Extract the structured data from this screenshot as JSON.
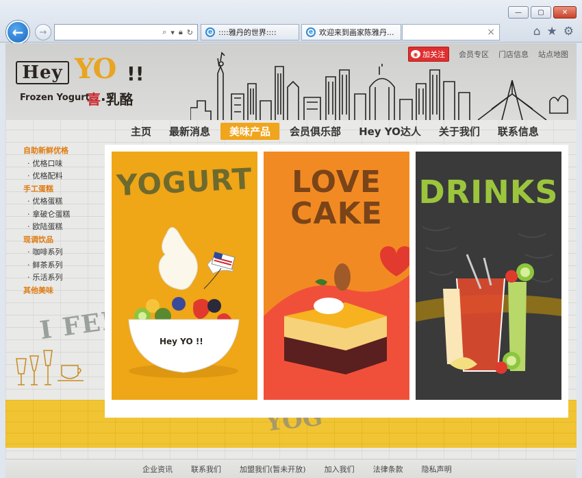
{
  "browser": {
    "tabs": [
      {
        "label": "::::雅丹的世界::::"
      },
      {
        "label": "欢迎来到画家陈雅丹..."
      }
    ],
    "window_buttons": {
      "minimize": "—",
      "maximize": "▢",
      "close": "✕"
    },
    "tab_close": "×",
    "icons": [
      "back-arrow-icon",
      "forward-arrow-icon",
      "search-icon",
      "lock-icon",
      "refresh-icon",
      "home-icon",
      "favorites-star-icon",
      "settings-gear-icon"
    ]
  },
  "logo": {
    "hey": "Hey",
    "yo": "YO",
    "bang": "!!",
    "subtitle": "Frozen Yogurt",
    "cn_first": "喜",
    "cn_rest": "·乳酪"
  },
  "top_links": {
    "weibo_follow": "加关注",
    "members": "会员专区",
    "stores": "门店信息",
    "sitemap": "站点地图"
  },
  "nav": [
    {
      "label": "主页",
      "active": false
    },
    {
      "label": "最新消息",
      "active": false
    },
    {
      "label": "美味产品",
      "active": true
    },
    {
      "label": "会员俱乐部",
      "active": false
    },
    {
      "label": "Hey YO达人",
      "active": false
    },
    {
      "label": "关于我们",
      "active": false
    },
    {
      "label": "联系信息",
      "active": false
    }
  ],
  "sidebar": [
    {
      "type": "cat",
      "label": "自助新鲜优格"
    },
    {
      "type": "sub",
      "label": "优格口味"
    },
    {
      "type": "sub",
      "label": "优格配料"
    },
    {
      "type": "cat",
      "label": "手工蛋糕"
    },
    {
      "type": "sub",
      "label": "优格蛋糕"
    },
    {
      "type": "sub",
      "label": "拿破仑蛋糕"
    },
    {
      "type": "sub",
      "label": "欧陆蛋糕"
    },
    {
      "type": "cat",
      "label": "现调饮品"
    },
    {
      "type": "sub",
      "label": "咖啡系列"
    },
    {
      "type": "sub",
      "label": "鲜茶系列"
    },
    {
      "type": "sub",
      "label": "乐活系列"
    },
    {
      "type": "cat",
      "label": "其他美味"
    }
  ],
  "cards": {
    "yogurt": {
      "title": "YOGURT",
      "cup_brand": "Hey YO !!"
    },
    "cake": {
      "title_line1": "LOVE",
      "title_line2": "CAKE"
    },
    "drinks": {
      "title": "DRINKS"
    }
  },
  "decor": {
    "wall_text": "I FEE",
    "yellow_scrawl": "YOG"
  },
  "footer": [
    {
      "label": "企业资讯"
    },
    {
      "label": "联系我们"
    },
    {
      "label": "加盟我们(暂未开放)"
    },
    {
      "label": "加入我们"
    },
    {
      "label": "法律条款"
    },
    {
      "label": "隐私声明"
    }
  ],
  "colors": {
    "brand_orange": "#f0a51d",
    "sidebar_category": "#e07a10",
    "yellow_band": "#f1c433",
    "drinks_green": "#9bc53d",
    "weibo_red": "#e02f2f"
  }
}
